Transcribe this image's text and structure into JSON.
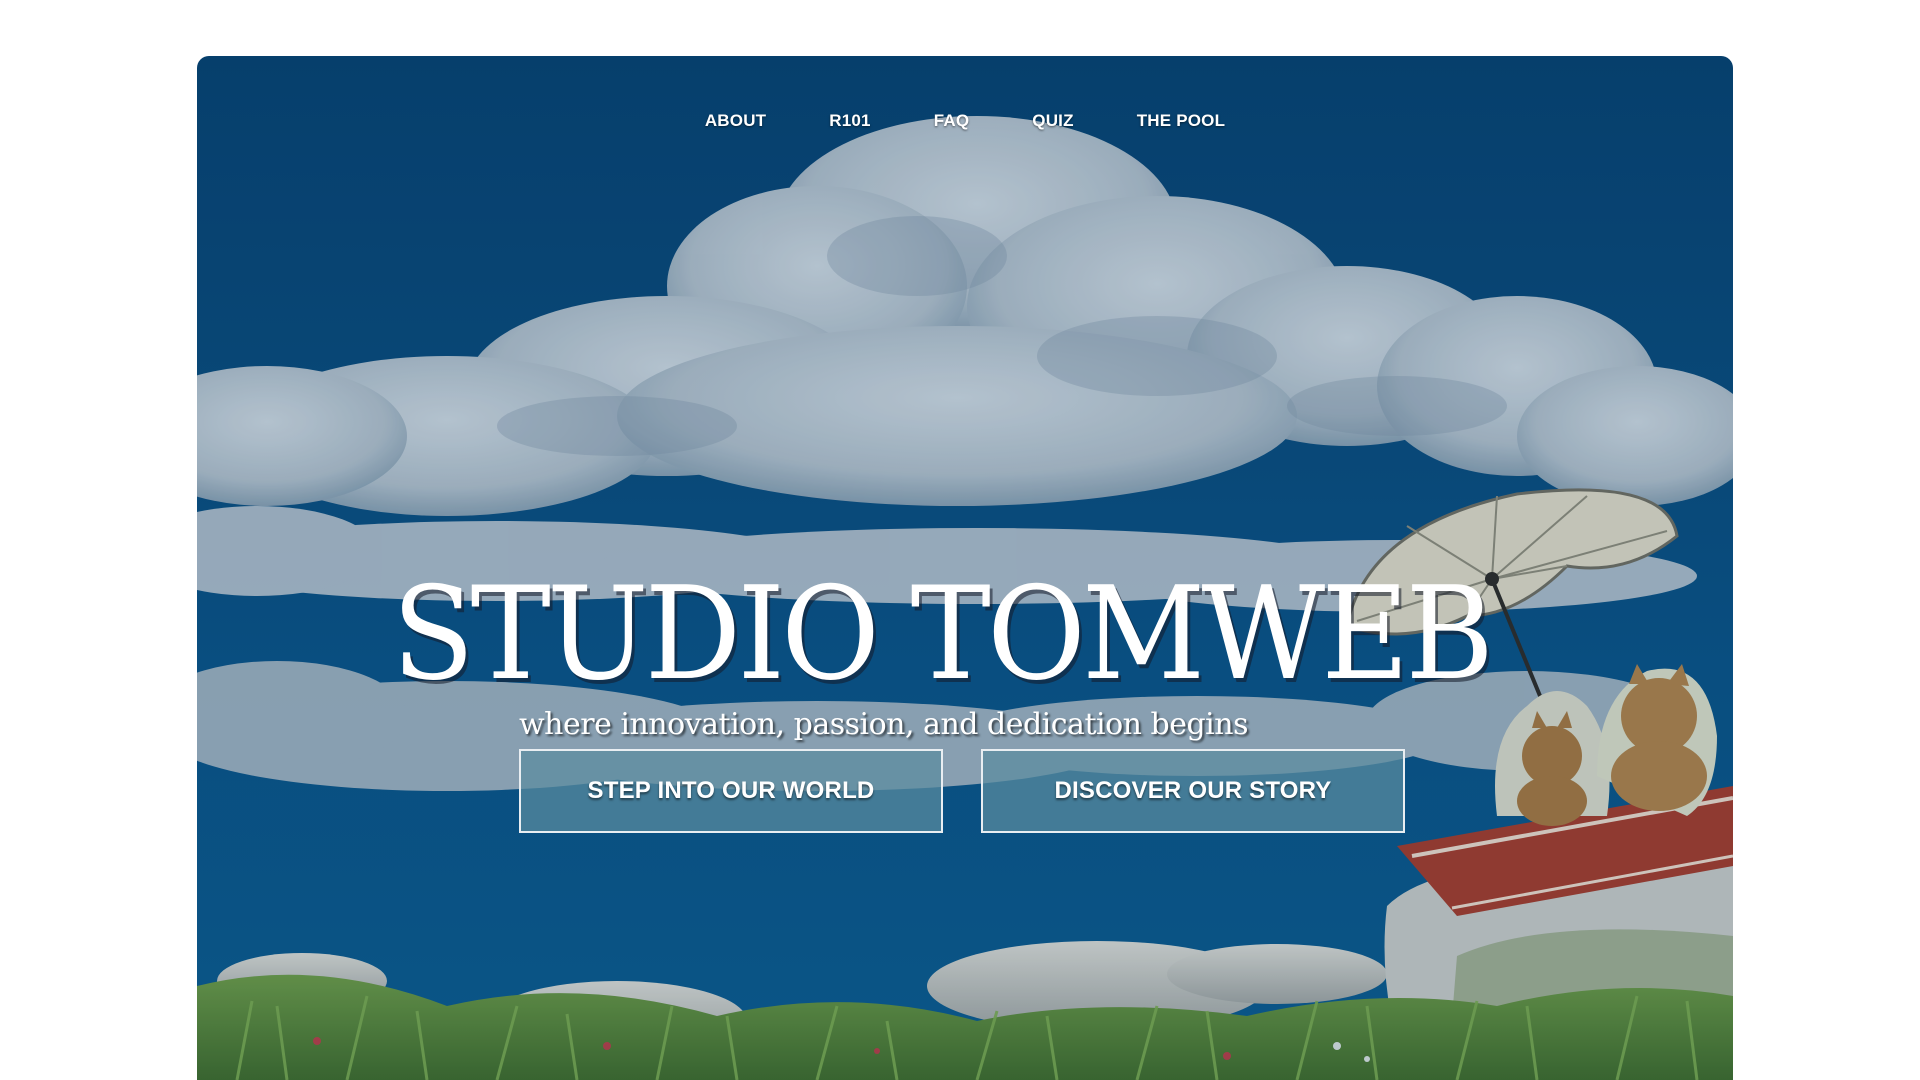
{
  "nav": {
    "items": [
      {
        "label": "ABOUT"
      },
      {
        "label": "R101"
      },
      {
        "label": "FAQ"
      },
      {
        "label": "QUIZ"
      },
      {
        "label": "THE POOL"
      }
    ]
  },
  "hero": {
    "title": "STUDIO TOMWEB",
    "subtitle": "where innovation, passion, and dedication begins",
    "primary_cta": "STEP INTO OUR WORLD",
    "secondary_cta": "DISCOVER OUR STORY"
  },
  "colors": {
    "sky": "#0a4a7a",
    "cloud": "#c9d1d8",
    "button_fill": "#5a8ca0",
    "grass": "#5f8a3a",
    "umbrella": "#dcd7c3",
    "blanket": "#a23b2b"
  }
}
